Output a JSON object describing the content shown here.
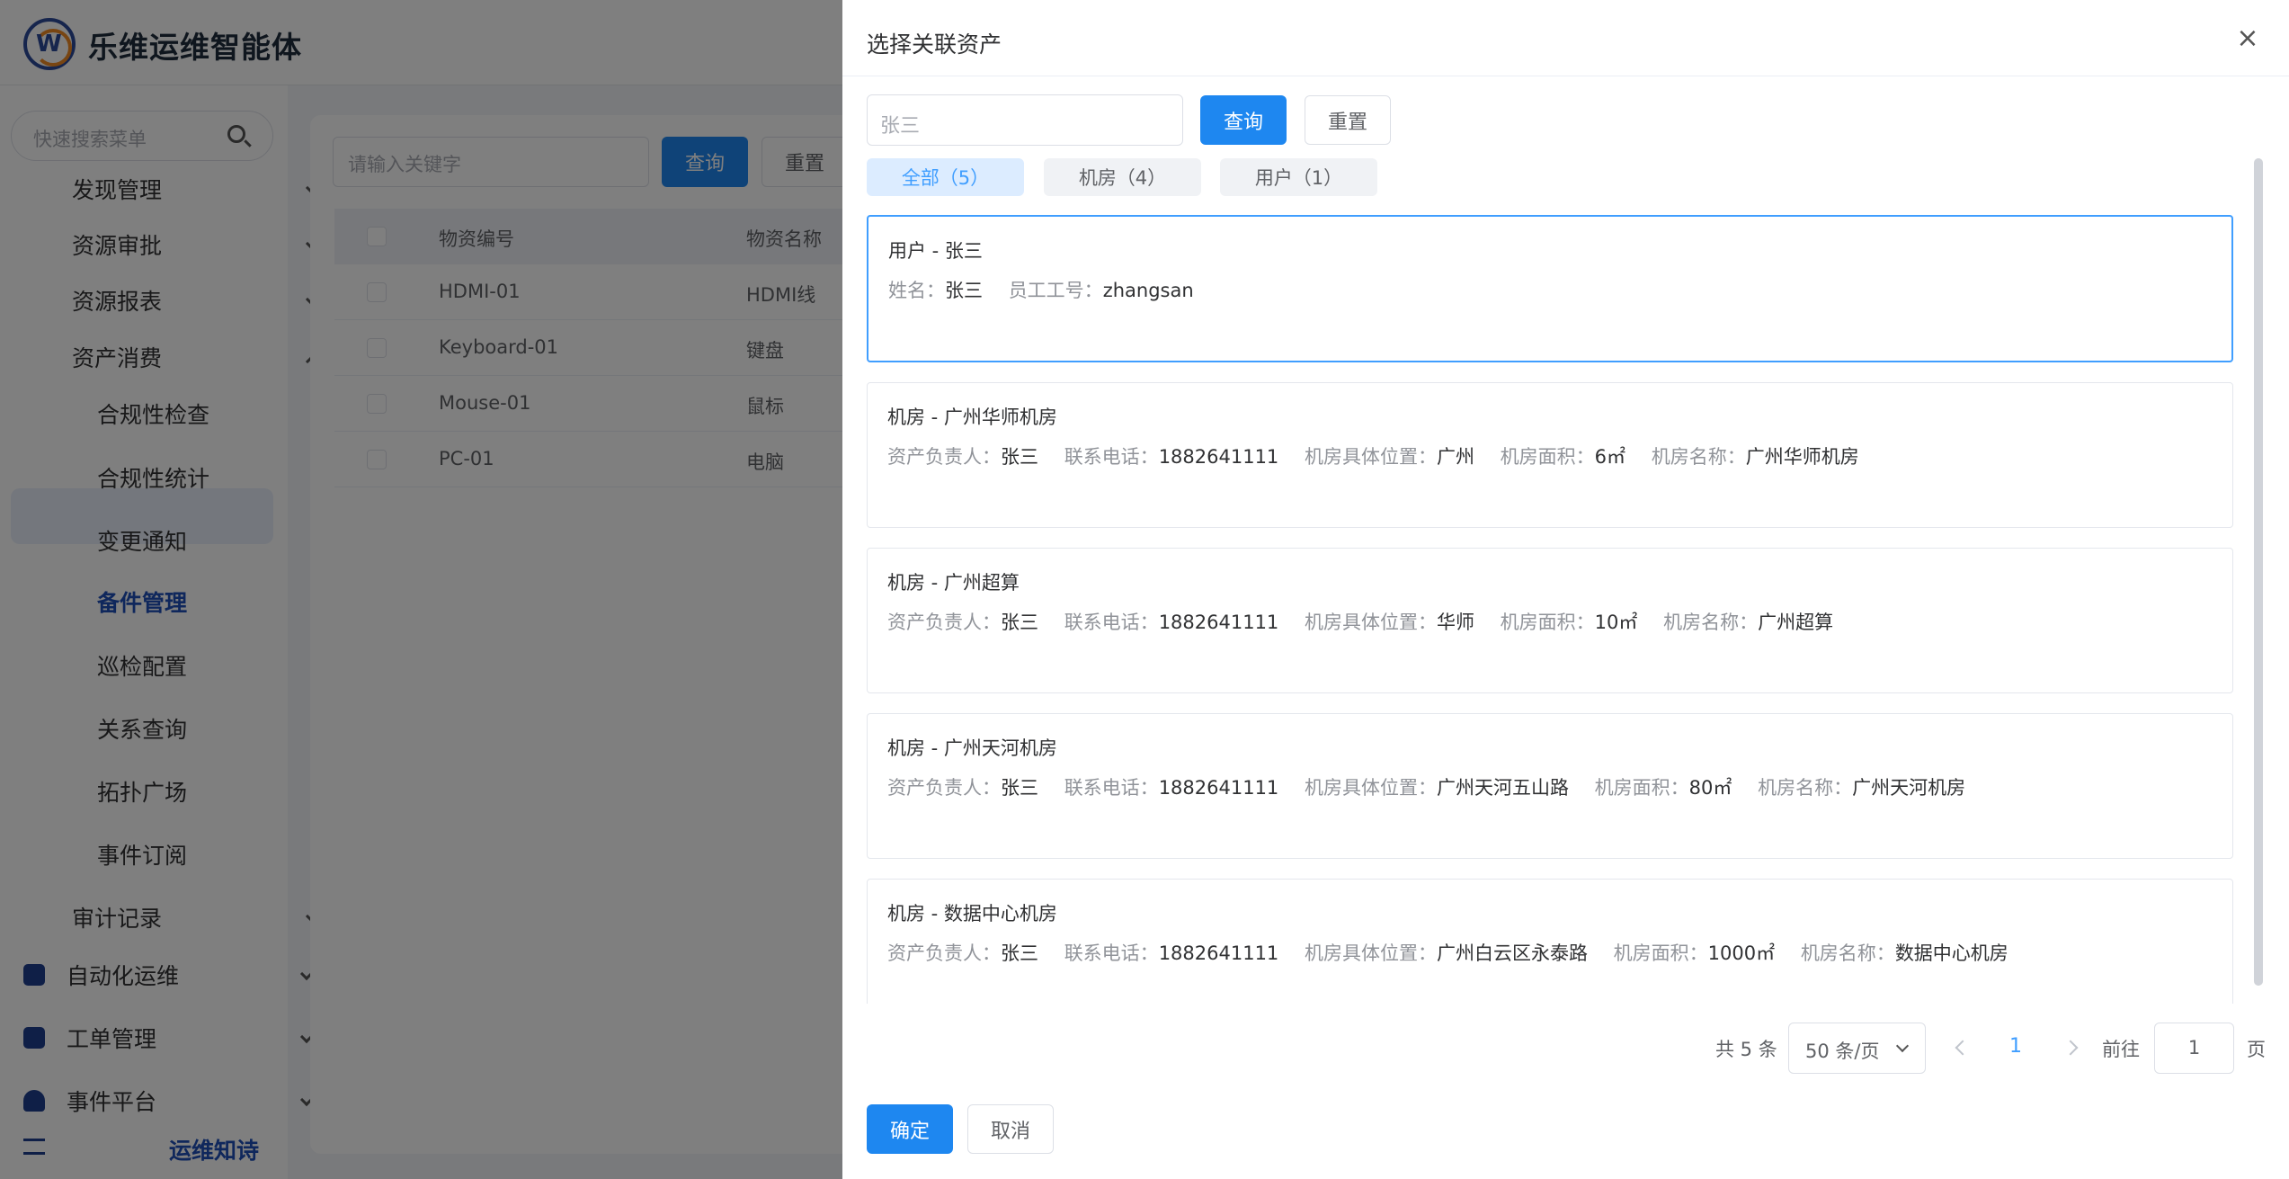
{
  "app": {
    "brand": "乐维运维智能体",
    "logo_letter": "W",
    "side_search_placeholder": "快速搜索菜单",
    "menu": [
      {
        "label": "发现管理"
      },
      {
        "label": "资源审批"
      },
      {
        "label": "资源报表"
      },
      {
        "label": "资产消费"
      },
      {
        "label": "合规性检查"
      },
      {
        "label": "合规性统计"
      },
      {
        "label": "变更通知"
      },
      {
        "label": "备件管理"
      },
      {
        "label": "巡检配置"
      },
      {
        "label": "关系查询"
      },
      {
        "label": "拓扑广场"
      },
      {
        "label": "事件订阅"
      },
      {
        "label": "审计记录"
      },
      {
        "label": "自动化运维"
      },
      {
        "label": "工单管理"
      },
      {
        "label": "事件平台"
      },
      {
        "label": "运维知诗"
      }
    ],
    "content": {
      "search_placeholder": "请输入关键字",
      "query_label": "查询",
      "reset_label": "重置",
      "columns": [
        "物资编号",
        "物资名称"
      ],
      "rows": [
        [
          "HDMI-01",
          "HDMI线"
        ],
        [
          "Keyboard-01",
          "键盘"
        ],
        [
          "Mouse-01",
          "鼠标"
        ],
        [
          "PC-01",
          "电脑"
        ]
      ]
    }
  },
  "drawer": {
    "title": "选择关联资产",
    "close_symbol": "×",
    "search_value": "张三",
    "query_label": "查询",
    "reset_label": "重置",
    "tabs": [
      {
        "label": "全部（5）",
        "active": true
      },
      {
        "label": "机房（4）",
        "active": false
      },
      {
        "label": "用户（1）",
        "active": false
      }
    ],
    "cards": [
      {
        "title": "用户 - 张三",
        "selected": true,
        "fields": [
          {
            "label": "姓名：",
            "value": "张三"
          },
          {
            "label": "员工工号：",
            "value": "zhangsan"
          }
        ]
      },
      {
        "title": "机房 - 广州华师机房",
        "selected": false,
        "fields": [
          {
            "label": "资产负责人：",
            "value": "张三"
          },
          {
            "label": "联系电话：",
            "value": "1882641111"
          },
          {
            "label": "机房具体位置：",
            "value": "广州"
          },
          {
            "label": "机房面积：",
            "value": "6㎡"
          },
          {
            "label": "机房名称：",
            "value": "广州华师机房"
          }
        ]
      },
      {
        "title": "机房 - 广州超算",
        "selected": false,
        "fields": [
          {
            "label": "资产负责人：",
            "value": "张三"
          },
          {
            "label": "联系电话：",
            "value": "1882641111"
          },
          {
            "label": "机房具体位置：",
            "value": "华师"
          },
          {
            "label": "机房面积：",
            "value": "10㎡"
          },
          {
            "label": "机房名称：",
            "value": "广州超算"
          }
        ]
      },
      {
        "title": "机房 - 广州天河机房",
        "selected": false,
        "fields": [
          {
            "label": "资产负责人：",
            "value": "张三"
          },
          {
            "label": "联系电话：",
            "value": "1882641111"
          },
          {
            "label": "机房具体位置：",
            "value": "广州天河五山路"
          },
          {
            "label": "机房面积：",
            "value": "80㎡"
          },
          {
            "label": "机房名称：",
            "value": "广州天河机房"
          }
        ]
      },
      {
        "title": "机房 - 数据中心机房",
        "selected": false,
        "fields": [
          {
            "label": "资产负责人：",
            "value": "张三"
          },
          {
            "label": "联系电话：",
            "value": "1882641111"
          },
          {
            "label": "机房具体位置：",
            "value": "广州白云区永泰路"
          },
          {
            "label": "机房面积：",
            "value": "1000㎡"
          },
          {
            "label": "机房名称：",
            "value": "数据中心机房"
          }
        ]
      }
    ],
    "pagination": {
      "total_text": "共 5 条",
      "page_size": "50 条/页",
      "current_page": "1",
      "goto_label": "前往",
      "goto_value": "1",
      "page_suffix": "页"
    },
    "confirm_label": "确定",
    "cancel_label": "取消"
  },
  "colors": {
    "primary": "#1e87f0",
    "accent_text": "#409eff",
    "active_tab_bg": "#dcecff",
    "menu_active_text": "#1f4fb8"
  }
}
